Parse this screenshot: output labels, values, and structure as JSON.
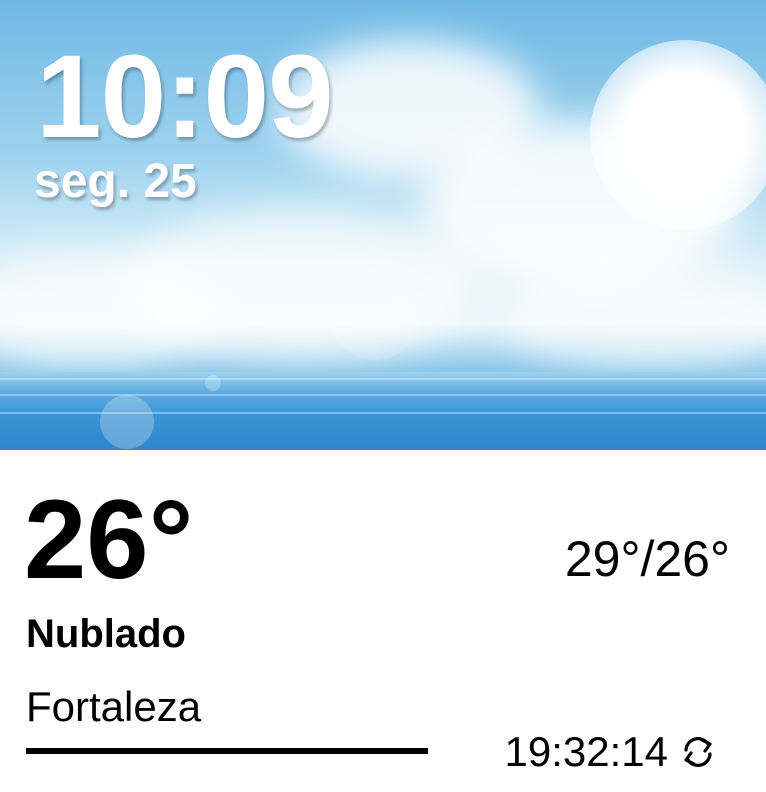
{
  "clock": {
    "time": "10:09",
    "date": "seg. 25"
  },
  "weather": {
    "current_temp": "26°",
    "high_low": "29°/26°",
    "condition": "Nublado",
    "location": "Fortaleza",
    "last_update": "19:32:14"
  },
  "icons": {
    "refresh": "refresh-icon"
  },
  "colors": {
    "sky_top": "#6fb9e4",
    "sea": "#2b86cf",
    "text_light": "#ffffff",
    "text_dark": "#000000"
  }
}
